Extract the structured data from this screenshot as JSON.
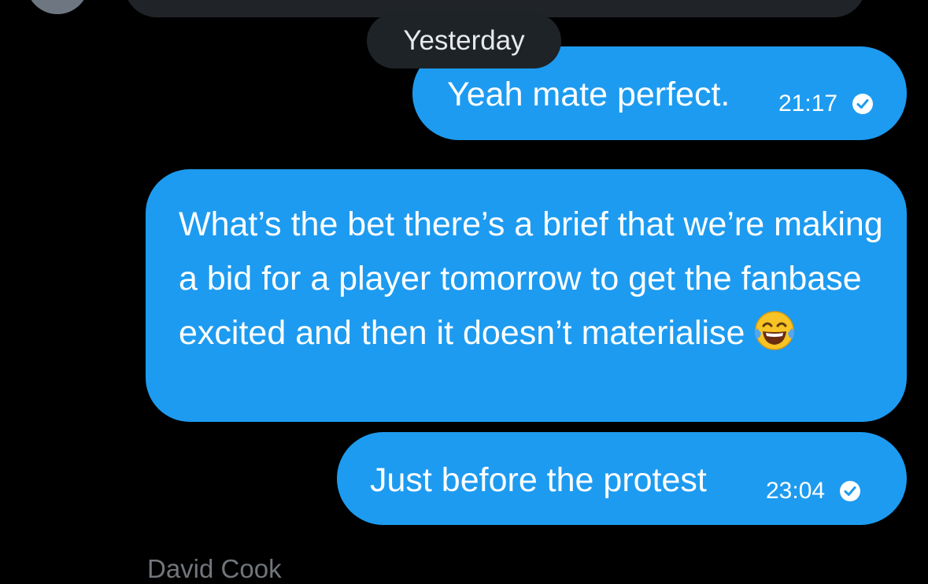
{
  "date_separator": "Yesterday",
  "messages": [
    {
      "text": "Yeah mate perfect.",
      "time": "21:17",
      "status": "sent",
      "status_icon": "check-circle-icon"
    },
    {
      "text": "What’s the bet there’s a brief that we’re making a bid for a player tomorrow to get the fanbase excited and then it doesn’t materialise",
      "emoji": "face-with-tears-of-joy"
    },
    {
      "text": "Just before the protest",
      "time": "23:04",
      "status": "sent",
      "status_icon": "check-circle-icon"
    }
  ],
  "next_sender": "David Cook",
  "colors": {
    "background": "#000000",
    "sent_bubble": "#1d9bf0",
    "date_pill": "#1e2328",
    "received_bubble": "#202327",
    "muted_text": "#71767b"
  }
}
